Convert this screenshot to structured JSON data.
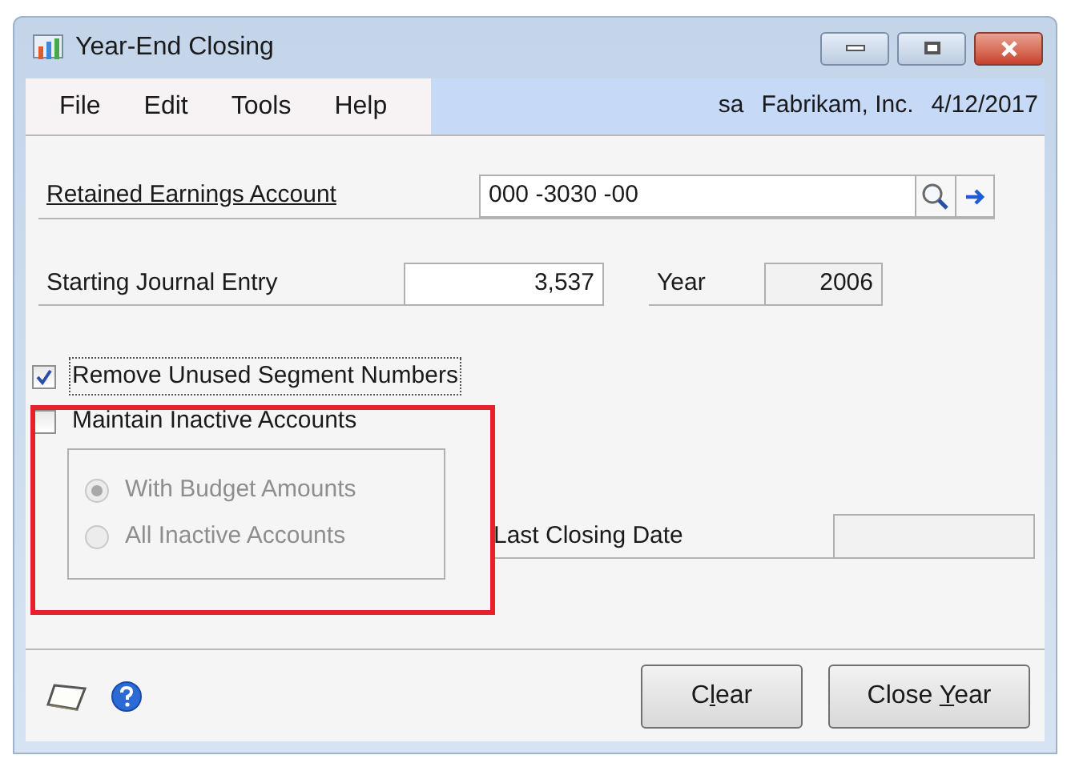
{
  "window": {
    "title": "Year-End Closing"
  },
  "menu": [
    "File",
    "Edit",
    "Tools",
    "Help"
  ],
  "session": {
    "user": "sa",
    "company": "Fabrikam, Inc.",
    "date": "4/12/2017"
  },
  "retained_earnings": {
    "label": "Retained Earnings Account",
    "value": "000 -3030 -00"
  },
  "starting_journal_entry": {
    "label": "Starting Journal Entry",
    "value": "3,537"
  },
  "year": {
    "label": "Year",
    "value": "2006"
  },
  "checkboxes": [
    {
      "label": "Remove Unused Segment Numbers",
      "checked": true,
      "focused": true
    },
    {
      "label": "Maintain Inactive Accounts",
      "checked": false,
      "focused": false
    }
  ],
  "radios": [
    {
      "label": "With Budget Amounts",
      "selected": true,
      "disabled": true
    },
    {
      "label": "All Inactive Accounts",
      "selected": false,
      "disabled": true
    }
  ],
  "last_closing_date": {
    "label": "Last Closing Date"
  },
  "highlight": {
    "color": "#e8202a"
  },
  "buttons": [
    {
      "parts": [
        "C",
        "l",
        "ear"
      ]
    },
    {
      "parts": [
        "Close ",
        "Y",
        "ear"
      ]
    }
  ]
}
